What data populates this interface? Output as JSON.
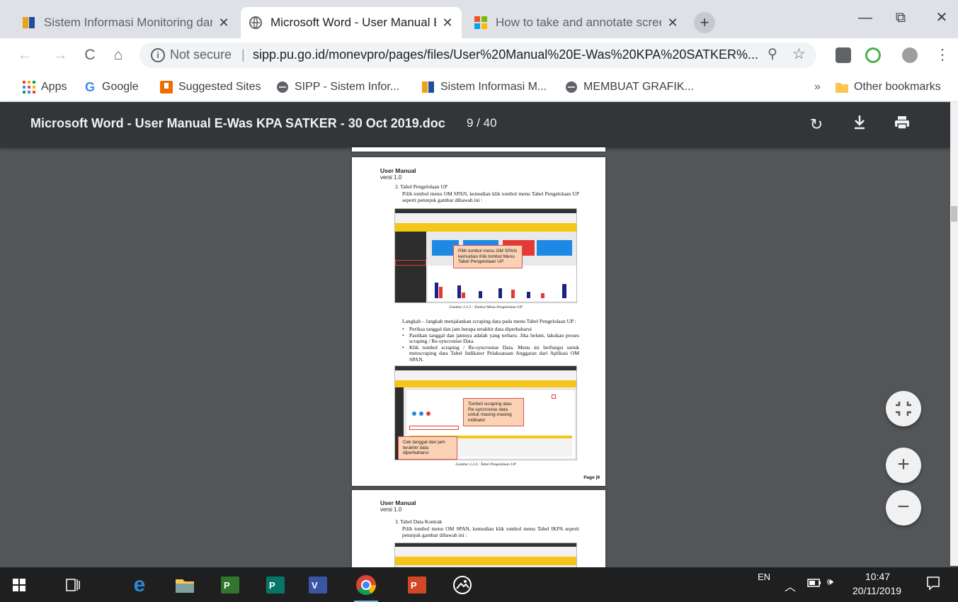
{
  "browser": {
    "tabs": [
      {
        "title": "Sistem Informasi Monitoring dan",
        "icon": "pupr-logo-icon",
        "active": false
      },
      {
        "title": "Microsoft Word - User Manual E-",
        "icon": "globe-icon",
        "active": true
      },
      {
        "title": "How to take and annotate screen",
        "icon": "windows-logo-icon",
        "active": false
      }
    ],
    "new_tab_label": "+",
    "window_controls": {
      "minimize": "—",
      "restore": "⧉",
      "close": "✕"
    },
    "toolbar": {
      "back": "←",
      "forward": "→",
      "reload": "C",
      "home": "⌂",
      "not_secure": "Not secure",
      "separator": "|",
      "url": "sipp.pu.go.id/monevpro/pages/files/User%20Manual%20E-Was%20KPA%20SATKER%...",
      "menu": "⋮"
    },
    "bookmarks": [
      {
        "label": "Apps",
        "icon": "apps-grid-icon"
      },
      {
        "label": "Google",
        "icon": "google-g-icon"
      },
      {
        "label": "Suggested Sites",
        "icon": "suggested-sites-icon"
      },
      {
        "label": "SIPP - Sistem Infor...",
        "icon": "globe-icon"
      },
      {
        "label": "Sistem Informasi M...",
        "icon": "pupr-logo-icon"
      },
      {
        "label": "MEMBUAT GRAFIK...",
        "icon": "globe-icon"
      }
    ],
    "bookmarks_overflow": "»",
    "other_bookmarks": "Other bookmarks"
  },
  "pdf_viewer": {
    "title": "Microsoft Word - User Manual E-Was KPA SATKER - 30 Oct 2019.doc",
    "page_indicator": "9 / 40",
    "zoom_buttons": {
      "fit": "fit-page-icon",
      "zoom_in": "+",
      "zoom_out": "−"
    }
  },
  "document": {
    "page9": {
      "header_title": "User Manual",
      "header_version": "versi 1.0",
      "section_title": "2.  Tabel Pengelolaan UP",
      "intro": "Pilih tombol menu OM SPAN, kemudian klik tombol menu Tabel Pengelolaan UP seperti petunjuk gambar dibawah ini :",
      "figure1_callout": "Pilih tombol menu OM SPAN kemudian Klik tombol Menu Tabel Pengelolaan UP",
      "figure1_caption": "Gambar 2.2.3 : Tombol Menu Pengelolaan UP",
      "steps_intro": "Langkah – langkah menjalankan scraping data pada menu Tabel Pengelolaan UP :",
      "steps": [
        "Periksa tanggal dan jam berapa terakhir data diperbaharui",
        "Pastikan tanggal dan jamnya adalah yang terbaru. Jika belum, lakukan proses scraping / Re-syncronise Data.",
        "Klik tombol scraping / Re-syncronise Data. Menu ini berfungsi untuk menscraping data Tabel Indikator Pelaksanaan Anggaran dari Aplikasi OM SPAN."
      ],
      "figure2_callout_a": "Tombol scraping atau Re-syncronise data untuk masing-masing indikator",
      "figure2_callout_b": "Cek tanggal dan jam terakhir data diperbaharui",
      "figure2_caption": "Gambar 2.2.4 : Tabel Pengelolaan UP",
      "footer": "Page |9"
    },
    "page10": {
      "header_title": "User Manual",
      "header_version": "versi 1.0",
      "section_title": "3.  Tabel Data Kontrak",
      "intro": "Pilih tombol menu OM SPAN, kemudian klik tombol menu Tabel IKPA seperti petunjuk gambar dibawah ini :"
    }
  },
  "taskbar": {
    "apps": [
      "windows-start-icon",
      "task-view-icon",
      "edge-icon",
      "file-explorer-icon",
      "project-icon",
      "publisher-icon",
      "visio-icon",
      "chrome-icon",
      "powerpoint-icon",
      "photos-icon"
    ],
    "language": "EN",
    "time": "10:47",
    "date": "20/11/2019"
  },
  "colors": {
    "pdf_bg": "#525659",
    "pdf_header": "#323639",
    "callout_fill": "#fbd2b4",
    "callout_border": "#d9534f",
    "taskbar": "#1f1f1f"
  }
}
